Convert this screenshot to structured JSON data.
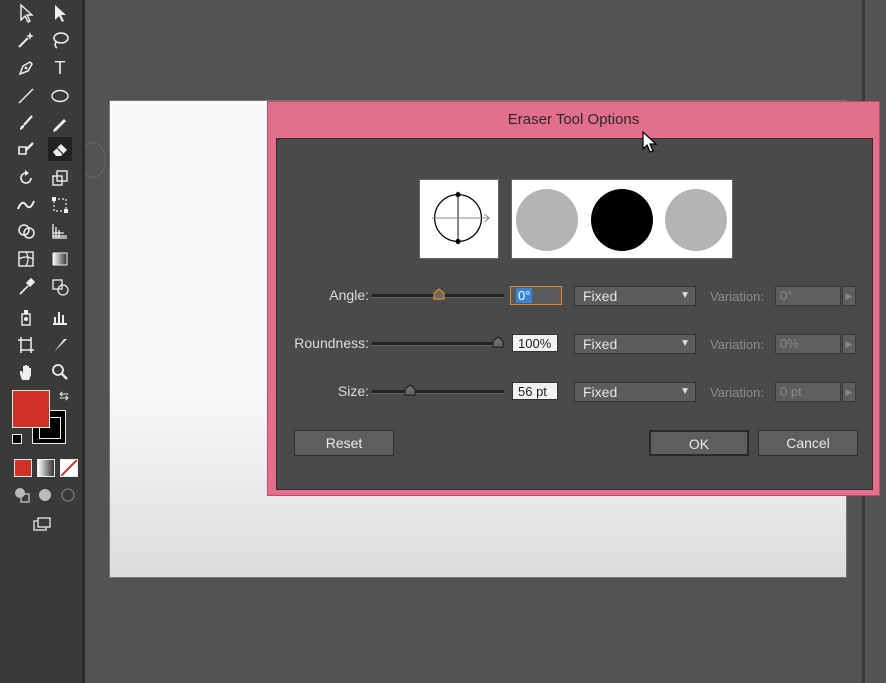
{
  "dialog": {
    "title": "Eraser Tool Options",
    "angle": {
      "label": "Angle:",
      "value": "0°",
      "mode": "Fixed",
      "variation_label": "Variation:",
      "variation_value": "0°",
      "slider_fraction": 0.5
    },
    "roundness": {
      "label": "Roundness:",
      "value": "100%",
      "mode": "Fixed",
      "variation_label": "Variation:",
      "variation_value": "0%",
      "slider_fraction": 1.0
    },
    "size": {
      "label": "Size:",
      "value": "56 pt",
      "mode": "Fixed",
      "variation_label": "Variation:",
      "variation_value": "0 pt",
      "slider_fraction": 0.29
    },
    "buttons": {
      "reset": "Reset",
      "ok": "OK",
      "cancel": "Cancel"
    }
  },
  "colors": {
    "fill": "#d03025",
    "stroke": "#000000",
    "dialog_frame": "#e36f8c",
    "selection": "#3a84d8"
  },
  "tools": [
    "selection-tool",
    "direct-selection-tool",
    "magic-wand-tool",
    "lasso-tool",
    "pen-tool",
    "type-tool",
    "line-tool",
    "ellipse-tool",
    "paintbrush-tool",
    "pencil-tool",
    "blob-brush-tool",
    "eraser-tool",
    "rotate-tool",
    "scale-tool",
    "width-tool",
    "free-transform-tool",
    "shape-builder-tool",
    "perspective-grid-tool",
    "mesh-tool",
    "gradient-tool",
    "eyedropper-tool",
    "blend-tool",
    "symbol-sprayer-tool",
    "column-graph-tool",
    "artboard-tool",
    "slice-tool",
    "hand-tool",
    "zoom-tool"
  ]
}
